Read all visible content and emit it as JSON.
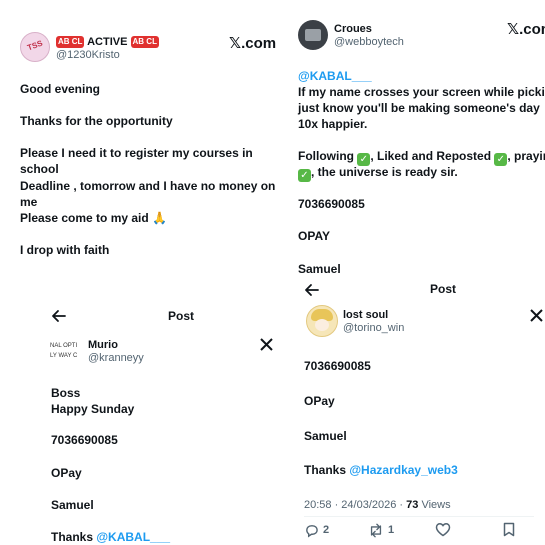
{
  "tl": {
    "badge1": "AB CL",
    "name": "ACTIVE",
    "badge2": "AB CL",
    "handle": "@1230Kristo",
    "x_logo": "𝕏.com",
    "avatar_text": "TSS",
    "lines": [
      "Good evening",
      "Thanks for the opportunity",
      "Please I need it to register my courses in",
      "school",
      "Deadline , tomorrow and I have no money on",
      "me",
      "Please come to my aid 🙏",
      "I drop with faith"
    ]
  },
  "tr": {
    "name": "Croues",
    "handle": "@webboytech",
    "x_logo": "𝕏.com",
    "mention": "@KABAL___",
    "lines": [
      "If my name crosses your screen while picking",
      "just know you'll be making someone's day",
      "10x happier."
    ],
    "following_line": {
      "part1": "Following",
      "part2": ", Liked and Reposted",
      "part3": ", praying",
      "part4": ", the universe is ready sir."
    },
    "account_number": "7036690085",
    "bank": "OPAY",
    "name_line": "Samuel"
  },
  "bl": {
    "header": "Post",
    "name": "Murio",
    "handle": "@kranneyy",
    "avatar_text_1": "NAL OPTI",
    "avatar_text_2": "LY WAY C",
    "lines": [
      "Boss",
      "Happy Sunday"
    ],
    "account_number": "7036690085",
    "bank": "OPay",
    "name_line": "Samuel",
    "thanks": "Thanks",
    "mention": "@KABAL___"
  },
  "br": {
    "header": "Post",
    "name": "lost soul",
    "handle": "@torino_win",
    "account_number": "7036690085",
    "bank": "OPay",
    "name_line": "Samuel",
    "thanks": "Thanks",
    "mention": "@Hazardkay_web3",
    "meta": "20:58 · 24/03/2026 · ",
    "views_count": "73",
    "views_label": "Views",
    "replies": "2",
    "reposts": "1"
  },
  "icons": [
    "back-arrow-icon",
    "x-logo-icon",
    "reply-icon",
    "repost-icon",
    "like-icon",
    "bookmark-icon",
    "check-icon",
    "pray-icon"
  ],
  "colors": {
    "link": "#1d9bf0",
    "badge": "#e0312f",
    "check": "#57b846",
    "text": "#0f1419",
    "muted": "#536471"
  }
}
